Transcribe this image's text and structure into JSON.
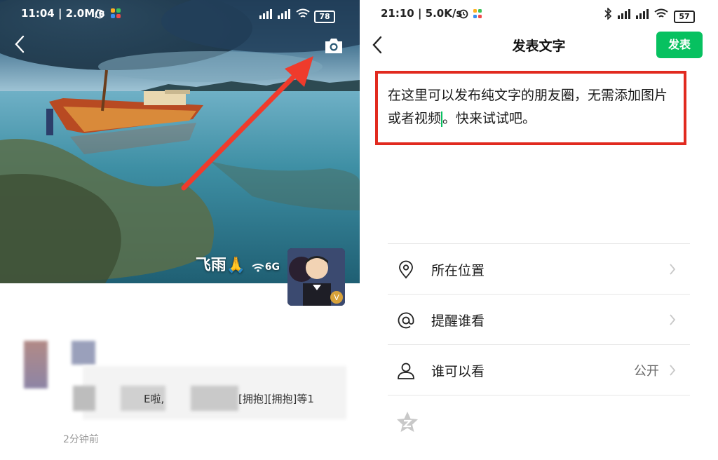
{
  "left": {
    "status_bar": {
      "time_speed": "11:04 | 2.0M/s",
      "battery": "78"
    },
    "profile": {
      "nickname": "飞雨🙏",
      "network": "6G"
    },
    "feed": {
      "text_fragment_1": "E啦,",
      "text_fragment_2": "[拥抱][拥抱]等1",
      "time": "2分钟前"
    }
  },
  "right": {
    "status_bar": {
      "time_speed": "21:10 | 5.0K/s",
      "battery": "57"
    },
    "header": {
      "title": "发表文字",
      "publish_label": "发表"
    },
    "compose": {
      "text_before_caret": "在这里可以发布纯文字的朋友圈，无需添加图片或者视频",
      "text_after_caret": "。快来试试吧。"
    },
    "options": [
      {
        "icon": "location-pin-icon",
        "label": "所在位置",
        "value": ""
      },
      {
        "icon": "at-sign-icon",
        "label": "提醒谁看",
        "value": ""
      },
      {
        "icon": "person-icon",
        "label": "谁可以看",
        "value": "公开"
      }
    ]
  },
  "colors": {
    "wechat_green": "#07c160",
    "highlight_red": "#e12a1f",
    "arrow_red": "#ef3b2c"
  }
}
